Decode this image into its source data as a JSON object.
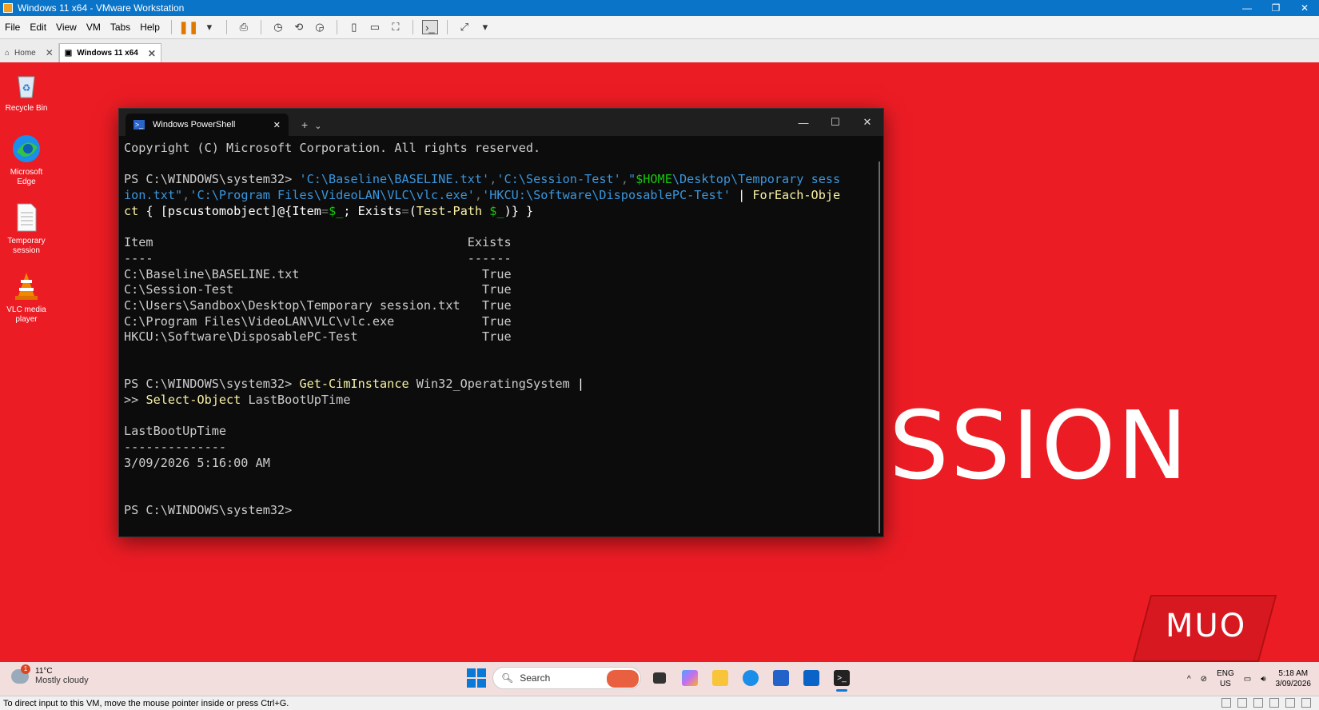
{
  "vm": {
    "title": "Windows 11 x64 - VMware Workstation",
    "min": "—",
    "max": "❐",
    "close": "✕",
    "menus": [
      "File",
      "Edit",
      "View",
      "VM",
      "Tabs",
      "Help"
    ],
    "tabs": [
      {
        "label": "Home"
      },
      {
        "label": "Windows 11 x64"
      }
    ],
    "status": "To direct input to this VM, move the mouse pointer inside or press Ctrl+G."
  },
  "desktop": {
    "icons": [
      {
        "label": "Recycle Bin"
      },
      {
        "label": "Microsoft Edge"
      },
      {
        "label": "Temporary session"
      },
      {
        "label": "VLC media player"
      }
    ],
    "bg_text": "SSION",
    "watermark": "MUO"
  },
  "terminal": {
    "tab_title": "Windows PowerShell",
    "icon_text": ">_",
    "new_tab": "+",
    "dropdown": "⌄",
    "lines": [
      [
        {
          "t": "Copyright (C) Microsoft Corporation. All rights reserved.",
          "c": ""
        }
      ],
      [
        {
          "t": "",
          "c": ""
        }
      ],
      [
        {
          "t": "PS C:\\WINDOWS\\system32> ",
          "c": ""
        },
        {
          "t": "'C:\\Baseline\\BASELINE.txt'",
          "c": "c-str"
        },
        {
          "t": ",",
          "c": "c-op"
        },
        {
          "t": "'C:\\Session-Test'",
          "c": "c-str"
        },
        {
          "t": ",",
          "c": "c-op"
        },
        {
          "t": "\"",
          "c": "c-str"
        },
        {
          "t": "$HOME",
          "c": "c-var"
        },
        {
          "t": "\\Desktop\\Temporary sess",
          "c": "c-str"
        }
      ],
      [
        {
          "t": "ion.txt\"",
          "c": "c-str"
        },
        {
          "t": ",",
          "c": "c-op"
        },
        {
          "t": "'C:\\Program Files\\VideoLAN\\VLC\\vlc.exe'",
          "c": "c-str"
        },
        {
          "t": ",",
          "c": "c-op"
        },
        {
          "t": "'HKCU:\\Software\\DisposablePC-Test'",
          "c": "c-str"
        },
        {
          "t": " | ",
          "c": "c-wht"
        },
        {
          "t": "ForEach-Obje",
          "c": "c-cmd"
        }
      ],
      [
        {
          "t": "ct",
          "c": "c-cmd"
        },
        {
          "t": " { [pscustomobject]@{",
          "c": "c-wht"
        },
        {
          "t": "Item",
          "c": "c-wht"
        },
        {
          "t": "=",
          "c": "c-op"
        },
        {
          "t": "$_",
          "c": "c-var"
        },
        {
          "t": "; ",
          "c": "c-wht"
        },
        {
          "t": "Exists",
          "c": "c-wht"
        },
        {
          "t": "=",
          "c": "c-op"
        },
        {
          "t": "(",
          "c": "c-wht"
        },
        {
          "t": "Test-Path",
          "c": "c-cmd"
        },
        {
          "t": " ",
          "c": ""
        },
        {
          "t": "$_",
          "c": "c-var"
        },
        {
          "t": ")} }",
          "c": "c-wht"
        }
      ],
      [
        {
          "t": "",
          "c": ""
        }
      ],
      [
        {
          "t": "Item                                           Exists",
          "c": ""
        }
      ],
      [
        {
          "t": "----                                           ------",
          "c": ""
        }
      ],
      [
        {
          "t": "C:\\Baseline\\BASELINE.txt                         True",
          "c": ""
        }
      ],
      [
        {
          "t": "C:\\Session-Test                                  True",
          "c": ""
        }
      ],
      [
        {
          "t": "C:\\Users\\Sandbox\\Desktop\\Temporary session.txt   True",
          "c": ""
        }
      ],
      [
        {
          "t": "C:\\Program Files\\VideoLAN\\VLC\\vlc.exe            True",
          "c": ""
        }
      ],
      [
        {
          "t": "HKCU:\\Software\\DisposablePC-Test                 True",
          "c": ""
        }
      ],
      [
        {
          "t": "",
          "c": ""
        }
      ],
      [
        {
          "t": "",
          "c": ""
        }
      ],
      [
        {
          "t": "PS C:\\WINDOWS\\system32> ",
          "c": ""
        },
        {
          "t": "Get-CimInstance",
          "c": "c-cmd"
        },
        {
          "t": " Win32_OperatingSystem ",
          "c": ""
        },
        {
          "t": "|",
          "c": "c-wht"
        }
      ],
      [
        {
          "t": ">> ",
          "c": ""
        },
        {
          "t": "Select-Object",
          "c": "c-cmd"
        },
        {
          "t": " LastBootUpTime",
          "c": ""
        }
      ],
      [
        {
          "t": "",
          "c": ""
        }
      ],
      [
        {
          "t": "LastBootUpTime",
          "c": ""
        }
      ],
      [
        {
          "t": "--------------",
          "c": ""
        }
      ],
      [
        {
          "t": "3/09/2026 5:16:00 AM",
          "c": ""
        }
      ],
      [
        {
          "t": "",
          "c": ""
        }
      ],
      [
        {
          "t": "",
          "c": ""
        }
      ],
      [
        {
          "t": "PS C:\\WINDOWS\\system32>",
          "c": ""
        }
      ]
    ]
  },
  "taskbar": {
    "weather_temp": "11°C",
    "weather_desc": "Mostly cloudy",
    "weather_badge": "1",
    "search_placeholder": "Search",
    "lang_1": "ENG",
    "lang_2": "US",
    "time": "5:18 AM",
    "date": "3/09/2026",
    "tray_chevron": "^"
  }
}
